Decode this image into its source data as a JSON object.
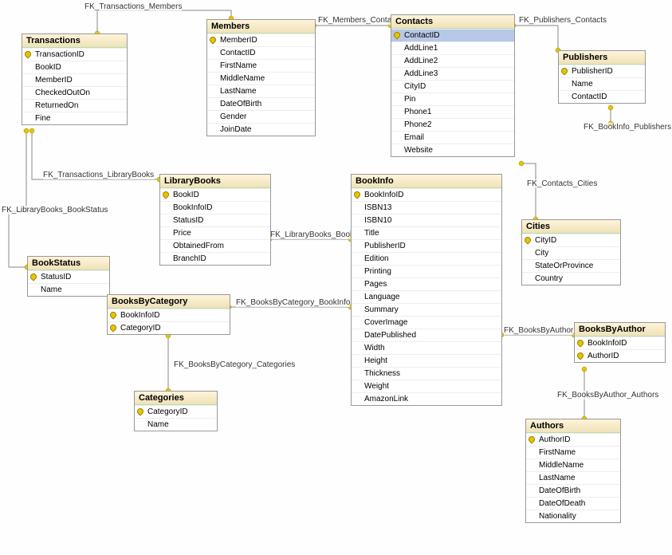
{
  "tables": {
    "transactions": {
      "title": "Transactions",
      "cols": [
        {
          "n": "TransactionID",
          "pk": true
        },
        {
          "n": "BookID"
        },
        {
          "n": "MemberID"
        },
        {
          "n": "CheckedOutOn"
        },
        {
          "n": "ReturnedOn"
        },
        {
          "n": "Fine"
        }
      ]
    },
    "members": {
      "title": "Members",
      "cols": [
        {
          "n": "MemberID",
          "pk": true
        },
        {
          "n": "ContactID"
        },
        {
          "n": "FirstName"
        },
        {
          "n": "MiddleName"
        },
        {
          "n": "LastName"
        },
        {
          "n": "DateOfBirth"
        },
        {
          "n": "Gender"
        },
        {
          "n": "JoinDate"
        }
      ]
    },
    "contacts": {
      "title": "Contacts",
      "cols": [
        {
          "n": "ContactID",
          "pk": true,
          "sel": true
        },
        {
          "n": "AddLine1"
        },
        {
          "n": "AddLine2"
        },
        {
          "n": "AddLine3"
        },
        {
          "n": "CityID"
        },
        {
          "n": "Pin"
        },
        {
          "n": "Phone1"
        },
        {
          "n": "Phone2"
        },
        {
          "n": "Email"
        },
        {
          "n": "Website"
        }
      ]
    },
    "publishers": {
      "title": "Publishers",
      "cols": [
        {
          "n": "PublisherID",
          "pk": true
        },
        {
          "n": "Name"
        },
        {
          "n": "ContactID"
        }
      ]
    },
    "librarybooks": {
      "title": "LibraryBooks",
      "cols": [
        {
          "n": "BookID",
          "pk": true
        },
        {
          "n": "BookInfoID"
        },
        {
          "n": "StatusID"
        },
        {
          "n": "Price"
        },
        {
          "n": "ObtainedFrom"
        },
        {
          "n": "BranchID"
        }
      ]
    },
    "bookinfo": {
      "title": "BookInfo",
      "cols": [
        {
          "n": "BookInfoID",
          "pk": true
        },
        {
          "n": "ISBN13"
        },
        {
          "n": "ISBN10"
        },
        {
          "n": "Title"
        },
        {
          "n": "PublisherID"
        },
        {
          "n": "Edition"
        },
        {
          "n": "Printing"
        },
        {
          "n": "Pages"
        },
        {
          "n": "Language"
        },
        {
          "n": "Summary"
        },
        {
          "n": "CoverImage"
        },
        {
          "n": "DatePublished"
        },
        {
          "n": "Width"
        },
        {
          "n": "Height"
        },
        {
          "n": "Thickness"
        },
        {
          "n": "Weight"
        },
        {
          "n": "AmazonLink"
        }
      ]
    },
    "cities": {
      "title": "Cities",
      "cols": [
        {
          "n": "CityID",
          "pk": true
        },
        {
          "n": "City"
        },
        {
          "n": "StateOrProvince"
        },
        {
          "n": "Country"
        }
      ]
    },
    "bookstatus": {
      "title": "BookStatus",
      "cols": [
        {
          "n": "StatusID",
          "pk": true
        },
        {
          "n": "Name"
        }
      ]
    },
    "booksbycategory": {
      "title": "BooksByCategory",
      "cols": [
        {
          "n": "BookInfoID",
          "pk": true
        },
        {
          "n": "CategoryID",
          "pk": true
        }
      ]
    },
    "categories": {
      "title": "Categories",
      "cols": [
        {
          "n": "CategoryID",
          "pk": true
        },
        {
          "n": "Name"
        }
      ]
    },
    "booksbyauthor": {
      "title": "BooksByAuthor",
      "cols": [
        {
          "n": "BookInfoID",
          "pk": true
        },
        {
          "n": "AuthorID",
          "pk": true
        }
      ]
    },
    "authors": {
      "title": "Authors",
      "cols": [
        {
          "n": "AuthorID",
          "pk": true
        },
        {
          "n": "FirstName"
        },
        {
          "n": "MiddleName"
        },
        {
          "n": "LastName"
        },
        {
          "n": "DateOfBirth"
        },
        {
          "n": "DateOfDeath"
        },
        {
          "n": "Nationality"
        }
      ]
    }
  },
  "relations": {
    "fk_transactions_members": "FK_Transactions_Members",
    "fk_members_contacts": "FK_Members_Contacts",
    "fk_publishers_contacts": "FK_Publishers_Contacts",
    "fk_bookinfo_publishers": "FK_BookInfo_Publishers",
    "fk_transactions_librarybooks": "FK_Transactions_LibraryBooks",
    "fk_librarybooks_bookstatus": "FK_LibraryBooks_BookStatus",
    "fk_librarybooks_bookinfo": "FK_LibraryBooks_BookInfo",
    "fk_contacts_cities": "FK_Contacts_Cities",
    "fk_booksbycategory_bookinfo": "FK_BooksByCategory_BookInfo",
    "fk_booksbycategory_categories": "FK_BooksByCategory_Categories",
    "fk_booksbyauthor_bookinfo": "FK_BooksByAuthor_BookInfo",
    "fk_booksbyauthor_authors": "FK_BooksByAuthor_Authors"
  }
}
